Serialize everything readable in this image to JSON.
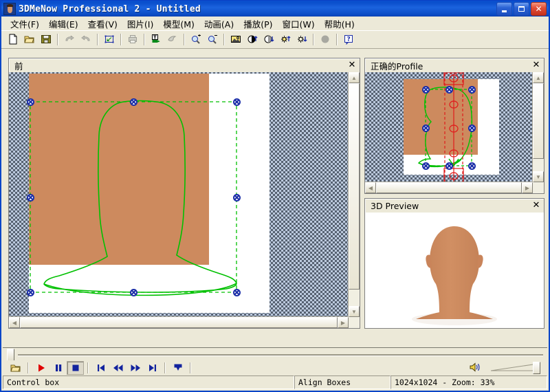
{
  "window": {
    "title": "3DMeNow Professional 2 - Untitled",
    "icon": "app-face-icon",
    "buttons": {
      "minimize": "_",
      "maximize": "□",
      "close": "✕"
    }
  },
  "menubar": {
    "items": [
      {
        "label": "文件(F)",
        "name": "menu-file"
      },
      {
        "label": "编辑(E)",
        "name": "menu-edit"
      },
      {
        "label": "查看(V)",
        "name": "menu-view"
      },
      {
        "label": "图片(I)",
        "name": "menu-picture"
      },
      {
        "label": "模型(M)",
        "name": "menu-model"
      },
      {
        "label": "动画(A)",
        "name": "menu-animation"
      },
      {
        "label": "播放(P)",
        "name": "menu-play"
      },
      {
        "label": "窗口(W)",
        "name": "menu-window"
      },
      {
        "label": "帮助(H)",
        "name": "menu-help"
      }
    ]
  },
  "toolbar": {
    "items": [
      "new-document-icon",
      "open-folder-icon",
      "save-disk-icon",
      "sep",
      "undo-arrow-icon",
      "redo-arrow-icon",
      "sep",
      "fit-to-window-icon",
      "sep",
      "print-icon",
      "sep",
      "apply-texture-icon",
      "morph-icon",
      "sep",
      "zoom-in-icon",
      "zoom-out-icon",
      "sep",
      "image-icon",
      "contrast-up-icon",
      "contrast-down-icon",
      "brightness-up-icon",
      "brightness-down-icon",
      "sep",
      "sphere-icon",
      "sep",
      "help-icon"
    ]
  },
  "panels": {
    "front": {
      "title": "前",
      "close": "✕",
      "name": "panel-front-view"
    },
    "profile": {
      "title": "正确的Profile",
      "close": "✕",
      "name": "panel-profile-view"
    },
    "preview": {
      "title": "3D Preview",
      "close": "✕",
      "name": "panel-3d-preview"
    }
  },
  "transport": {
    "buttons": [
      {
        "name": "open-animation-button",
        "icon": "open-folder-icon"
      },
      {
        "name": "play-button",
        "icon": "play-icon"
      },
      {
        "name": "pause-button",
        "icon": "pause-icon"
      },
      {
        "name": "stop-button",
        "icon": "stop-icon",
        "pressed": true
      },
      {
        "name": "first-frame-button",
        "icon": "skip-start-icon"
      },
      {
        "name": "rewind-button",
        "icon": "rewind-icon"
      },
      {
        "name": "fast-forward-button",
        "icon": "fast-forward-icon"
      },
      {
        "name": "last-frame-button",
        "icon": "skip-end-icon"
      },
      {
        "name": "loop-button",
        "icon": "loop-icon"
      }
    ],
    "volume_icon": "speaker-icon"
  },
  "statusbar": {
    "message": "Control box",
    "mode": "Align Boxes",
    "zoom_info": "1024x1024 - Zoom: 33%"
  },
  "colors": {
    "skin": "#cd8a5e",
    "outline_green": "#00c000",
    "handle_blue": "#1b2ea8",
    "guide_red": "#e01b1b",
    "titlebar_blue": "#0a4ecb",
    "face_bg": "#ece9d8"
  }
}
